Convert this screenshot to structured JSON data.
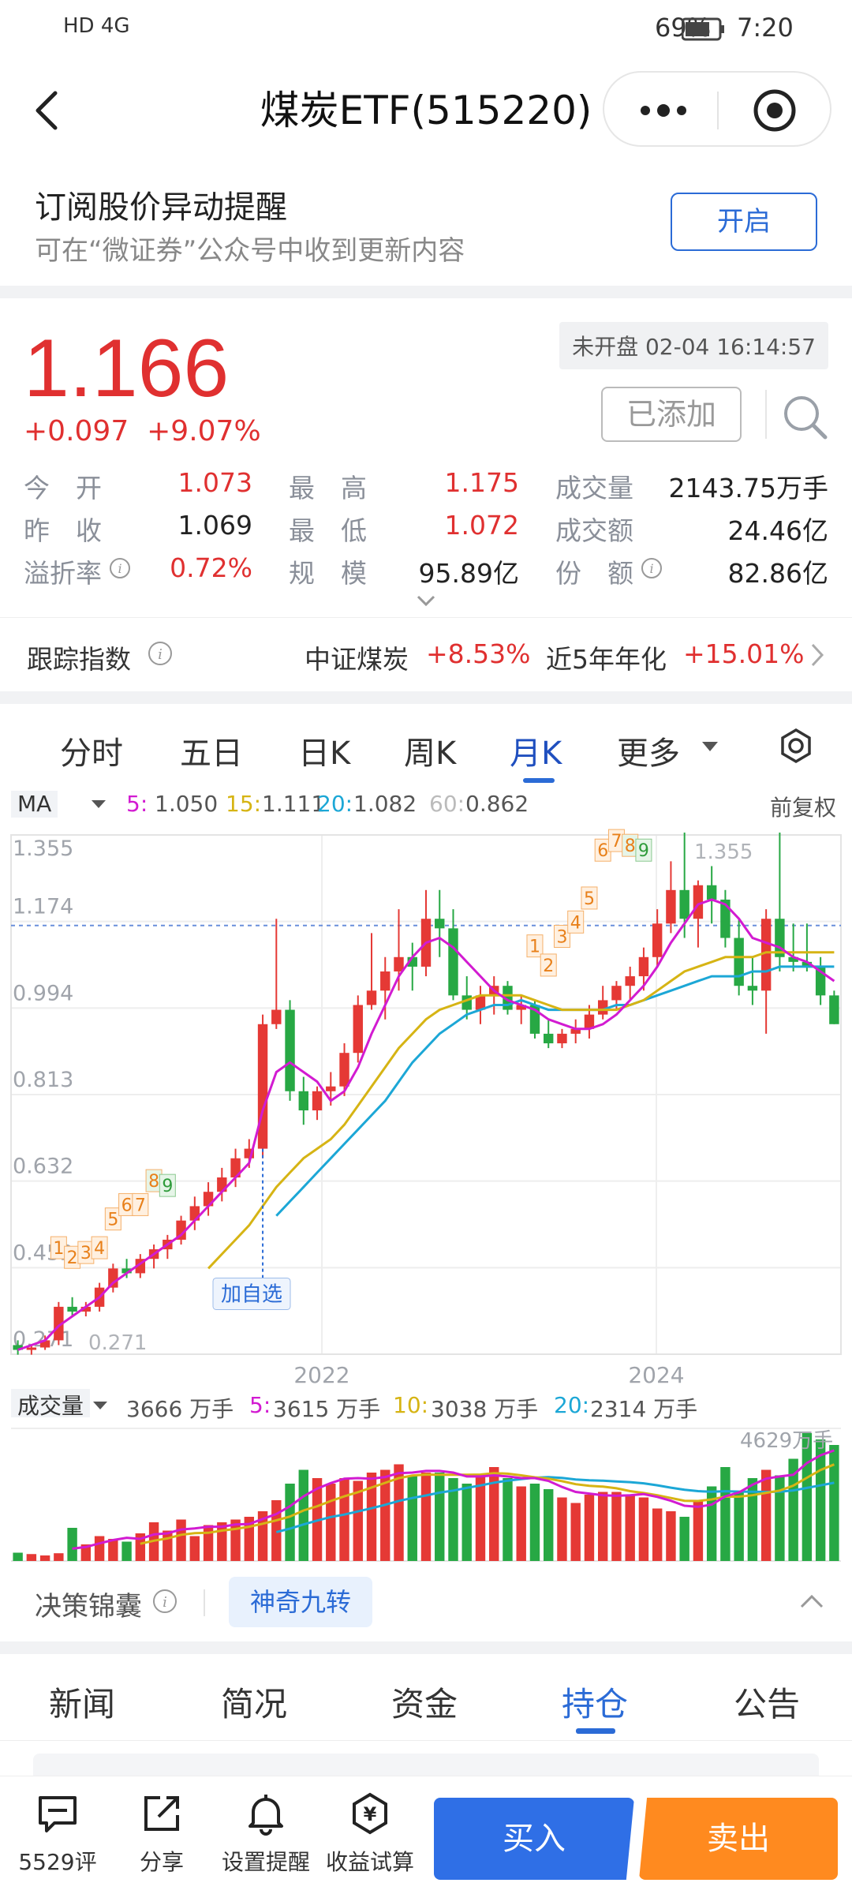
{
  "status_bar": {
    "network": "HD 4G",
    "battery": "69%",
    "time": "7:20"
  },
  "nav": {
    "title": "煤炭ETF(515220)",
    "back_icon": "chevron-left-icon",
    "more_icon": "ellipsis-icon",
    "target_icon": "target-icon"
  },
  "subscribe": {
    "title": "订阅股价异动提醒",
    "desc": "可在“微证券”公众号中收到更新内容",
    "button": "开启"
  },
  "quote": {
    "price": "1.166",
    "change": "+0.097",
    "change_pct": "+9.07%",
    "market_status": "未开盘 02-04 16:14:57",
    "added_button": "已添加",
    "stats": [
      {
        "label": "今　开",
        "value": "1.073"
      },
      {
        "label": "最　高",
        "value": "1.175"
      },
      {
        "label": "成交量",
        "value": "2143.75万手"
      },
      {
        "label": "昨　收",
        "value": "1.069"
      },
      {
        "label": "最　低",
        "value": "1.072"
      },
      {
        "label": "成交额",
        "value": "24.46亿"
      },
      {
        "label": "溢折率",
        "value": "0.72%"
      },
      {
        "label": "规　模",
        "value": "95.89亿"
      },
      {
        "label": "份　额",
        "value": "82.86亿"
      }
    ]
  },
  "tracking": {
    "label": "跟踪指数",
    "index_name": "中证煤炭",
    "index_change": "+8.53%",
    "annual_label": "近5年年化",
    "annual_value": "+15.01%"
  },
  "chart_tabs": {
    "items": [
      "分时",
      "五日",
      "日K",
      "周K",
      "月K",
      "更多"
    ],
    "active": 4
  },
  "ma": {
    "name": "MA",
    "ma5_label": "5:",
    "ma5": "1.050",
    "ma15_label": "15:",
    "ma15": "1.111",
    "ma20_label": "20:",
    "ma20": "1.082",
    "ma60_label": "60:",
    "ma60": "0.862",
    "adjust": "前复权"
  },
  "chart_data": {
    "type": "candlestick",
    "y_ticks": [
      "1.355",
      "1.174",
      "0.994",
      "0.813",
      "0.632",
      "0.452",
      "0.271"
    ],
    "ylim": [
      0.271,
      1.355
    ],
    "x_ticks": [
      "2022",
      "2024"
    ],
    "high_label": "1.355",
    "low_label": "0.271",
    "add_label": "加自选",
    "ohlc": [
      [
        0.29,
        0.3,
        0.27,
        0.28
      ],
      [
        0.28,
        0.29,
        0.27,
        0.285
      ],
      [
        0.285,
        0.31,
        0.28,
        0.3
      ],
      [
        0.3,
        0.38,
        0.29,
        0.37
      ],
      [
        0.37,
        0.39,
        0.35,
        0.36
      ],
      [
        0.36,
        0.38,
        0.35,
        0.37
      ],
      [
        0.37,
        0.42,
        0.36,
        0.41
      ],
      [
        0.41,
        0.46,
        0.4,
        0.45
      ],
      [
        0.45,
        0.47,
        0.43,
        0.44
      ],
      [
        0.44,
        0.48,
        0.43,
        0.47
      ],
      [
        0.47,
        0.5,
        0.45,
        0.49
      ],
      [
        0.49,
        0.52,
        0.47,
        0.51
      ],
      [
        0.51,
        0.56,
        0.5,
        0.55
      ],
      [
        0.55,
        0.6,
        0.53,
        0.58
      ],
      [
        0.58,
        0.63,
        0.56,
        0.61
      ],
      [
        0.61,
        0.66,
        0.59,
        0.64
      ],
      [
        0.64,
        0.7,
        0.62,
        0.68
      ],
      [
        0.68,
        0.72,
        0.66,
        0.7
      ],
      [
        0.7,
        0.98,
        0.68,
        0.96
      ],
      [
        0.96,
        1.18,
        0.95,
        0.99
      ],
      [
        0.99,
        1.01,
        0.8,
        0.82
      ],
      [
        0.82,
        0.85,
        0.75,
        0.78
      ],
      [
        0.78,
        0.83,
        0.76,
        0.82
      ],
      [
        0.82,
        0.86,
        0.79,
        0.83
      ],
      [
        0.83,
        0.92,
        0.81,
        0.9
      ],
      [
        0.9,
        1.02,
        0.88,
        1.0
      ],
      [
        1.0,
        1.15,
        0.99,
        1.03
      ],
      [
        1.03,
        1.1,
        0.97,
        1.07
      ],
      [
        1.07,
        1.2,
        1.03,
        1.1
      ],
      [
        1.1,
        1.13,
        1.03,
        1.08
      ],
      [
        1.08,
        1.24,
        1.06,
        1.18
      ],
      [
        1.18,
        1.24,
        1.1,
        1.16
      ],
      [
        1.16,
        1.2,
        1.01,
        1.02
      ],
      [
        1.02,
        1.06,
        0.97,
        0.99
      ],
      [
        0.99,
        1.04,
        0.96,
        1.02
      ],
      [
        1.02,
        1.06,
        0.98,
        1.04
      ],
      [
        1.04,
        1.05,
        0.98,
        0.99
      ],
      [
        0.99,
        1.02,
        0.96,
        1.0
      ],
      [
        1.0,
        1.01,
        0.93,
        0.94
      ],
      [
        0.94,
        0.97,
        0.91,
        0.92
      ],
      [
        0.92,
        0.95,
        0.91,
        0.94
      ],
      [
        0.94,
        0.97,
        0.92,
        0.95
      ],
      [
        0.95,
        1.0,
        0.93,
        0.98
      ],
      [
        0.98,
        1.04,
        0.97,
        1.01
      ],
      [
        1.01,
        1.05,
        0.99,
        1.04
      ],
      [
        1.04,
        1.08,
        1.01,
        1.06
      ],
      [
        1.06,
        1.12,
        1.03,
        1.1
      ],
      [
        1.1,
        1.2,
        1.08,
        1.17
      ],
      [
        1.17,
        1.3,
        1.15,
        1.24
      ],
      [
        1.24,
        1.36,
        1.14,
        1.18
      ],
      [
        1.18,
        1.26,
        1.12,
        1.25
      ],
      [
        1.25,
        1.29,
        1.17,
        1.22
      ],
      [
        1.22,
        1.24,
        1.12,
        1.14
      ],
      [
        1.14,
        1.18,
        1.02,
        1.04
      ],
      [
        1.04,
        1.1,
        1.0,
        1.03
      ],
      [
        1.03,
        1.2,
        0.94,
        1.18
      ],
      [
        1.18,
        1.36,
        1.07,
        1.1
      ],
      [
        1.1,
        1.17,
        1.07,
        1.09
      ],
      [
        1.09,
        1.17,
        1.07,
        1.08
      ],
      [
        1.08,
        1.1,
        1.0,
        1.02
      ],
      [
        1.02,
        1.03,
        0.96,
        0.96
      ]
    ],
    "ma5": [
      0.28,
      0.29,
      0.3,
      0.33,
      0.35,
      0.37,
      0.39,
      0.42,
      0.44,
      0.46,
      0.48,
      0.5,
      0.52,
      0.55,
      0.58,
      0.61,
      0.64,
      0.67,
      0.78,
      0.86,
      0.88,
      0.86,
      0.84,
      0.8,
      0.82,
      0.87,
      0.94,
      1.0,
      1.06,
      1.1,
      1.13,
      1.14,
      1.12,
      1.09,
      1.06,
      1.03,
      1.01,
      1.0,
      0.99,
      0.97,
      0.96,
      0.95,
      0.95,
      0.96,
      0.98,
      1.01,
      1.04,
      1.08,
      1.13,
      1.17,
      1.21,
      1.22,
      1.21,
      1.18,
      1.14,
      1.13,
      1.12,
      1.1,
      1.09,
      1.07,
      1.05
    ],
    "ma15": [
      null,
      null,
      null,
      null,
      null,
      null,
      null,
      null,
      null,
      null,
      null,
      null,
      null,
      null,
      0.45,
      0.48,
      0.51,
      0.54,
      0.58,
      0.62,
      0.65,
      0.68,
      0.7,
      0.72,
      0.75,
      0.79,
      0.83,
      0.87,
      0.91,
      0.94,
      0.97,
      0.99,
      1.0,
      1.01,
      1.02,
      1.02,
      1.02,
      1.02,
      1.01,
      1.0,
      0.99,
      0.99,
      0.99,
      0.99,
      0.99,
      1.0,
      1.01,
      1.03,
      1.05,
      1.07,
      1.08,
      1.09,
      1.1,
      1.1,
      1.1,
      1.11,
      1.11,
      1.11,
      1.11,
      1.11,
      1.11
    ],
    "ma20": [
      null,
      null,
      null,
      null,
      null,
      null,
      null,
      null,
      null,
      null,
      null,
      null,
      null,
      null,
      null,
      null,
      null,
      null,
      null,
      0.56,
      0.59,
      0.62,
      0.65,
      0.68,
      0.71,
      0.74,
      0.77,
      0.8,
      0.84,
      0.88,
      0.91,
      0.94,
      0.96,
      0.98,
      0.99,
      1.0,
      1.0,
      1.01,
      1.0,
      0.99,
      0.99,
      0.99,
      0.99,
      0.99,
      1.0,
      1.0,
      1.01,
      1.02,
      1.03,
      1.04,
      1.05,
      1.06,
      1.06,
      1.06,
      1.07,
      1.07,
      1.08,
      1.08,
      1.08,
      1.08,
      1.08
    ],
    "nine_turn_labels": [
      "1",
      "2",
      "3",
      "4",
      "5",
      "6",
      "7",
      "8",
      "9"
    ]
  },
  "volume": {
    "label": "成交量",
    "current": "3666 万手",
    "ma5_label": "5:",
    "ma5": "3615 万手",
    "ma10_label": "10:",
    "ma10": "3038 万手",
    "ma20_label": "20:",
    "ma20": "2314 万手",
    "max_label": "4629万手",
    "values": [
      300,
      250,
      200,
      280,
      1200,
      600,
      900,
      800,
      700,
      1000,
      1400,
      1100,
      1500,
      900,
      1300,
      1400,
      1500,
      1600,
      1800,
      2200,
      2800,
      3300,
      3000,
      2800,
      3000,
      2900,
      3200,
      3300,
      3500,
      3100,
      3200,
      3200,
      3000,
      2800,
      3100,
      3400,
      3000,
      2700,
      2800,
      2600,
      2300,
      2100,
      2400,
      2500,
      2500,
      2400,
      2300,
      1900,
      1800,
      1600,
      2200,
      2700,
      3400,
      2500,
      3000,
      3300,
      3100,
      3700,
      4629,
      4400,
      4200
    ]
  },
  "decision": {
    "label": "决策锦囊",
    "chip": "神奇九转"
  },
  "news_tabs": {
    "items": [
      "新闻",
      "简况",
      "资金",
      "持仓",
      "公告"
    ],
    "active": 3
  },
  "bottom_bar": {
    "items": [
      {
        "icon": "comment-icon",
        "label": "5529评"
      },
      {
        "icon": "share-icon",
        "label": "分享"
      },
      {
        "icon": "bell-icon",
        "label": "设置提醒"
      },
      {
        "icon": "yen-icon",
        "label": "收益试算"
      }
    ],
    "buy": "买入",
    "sell": "卖出"
  },
  "colors": {
    "up": "#e53935",
    "down": "#27a844",
    "ma5": "#d21bd1",
    "ma15": "#d6b414",
    "ma20": "#1ca7d6",
    "accent": "#2b6bd6"
  }
}
